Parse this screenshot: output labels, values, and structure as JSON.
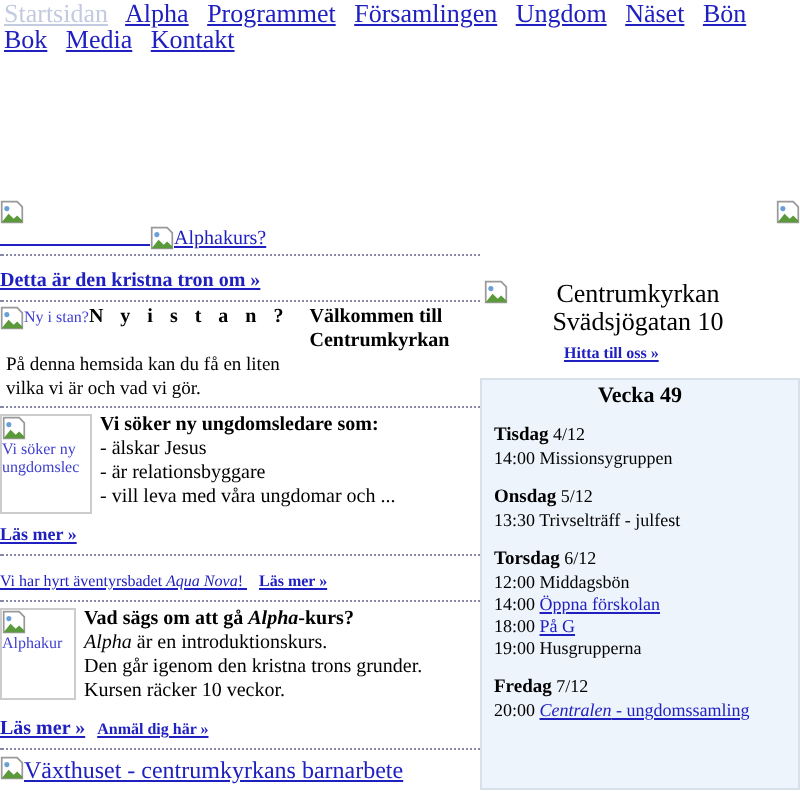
{
  "nav": [
    {
      "label": "Startsidan",
      "selected": true
    },
    {
      "label": "Alpha",
      "selected": false
    },
    {
      "label": "Programmet",
      "selected": false
    },
    {
      "label": "Församlingen",
      "selected": false
    },
    {
      "label": "Ungdom",
      "selected": false
    },
    {
      "label": "Näset",
      "selected": false
    },
    {
      "label": "Bön",
      "selected": false
    },
    {
      "label": "Bok",
      "selected": false
    },
    {
      "label": "Media",
      "selected": false
    },
    {
      "label": "Kontakt",
      "selected": false
    }
  ],
  "left": {
    "alpha_link": "Alphakurs?",
    "faith_link": "Detta är den kristna tron om »",
    "welcome": {
      "image_alt": "Ny i stan?",
      "title": "N y i s t a n ?",
      "heading": "Välkommen till Centrumkyrkan",
      "lines": [
        "På denna hemsida kan du få en liten",
        "vilka vi är och vad vi gör."
      ]
    },
    "youth": {
      "image_alt": "Vi söker ny ungdomslec",
      "heading": "Vi söker ny ungdomsledare som:",
      "lines": [
        "- älskar Jesus",
        "- är relationsbyggare",
        "- vill leva med våra ungdomar och ..."
      ],
      "link": "Läs mer »"
    },
    "aqua": {
      "text": "Vi har hyrt äventyrsbadet *Aqua Nova*!",
      "link": "Läs mer »"
    },
    "alpha": {
      "image_alt": "Alphakur",
      "heading": "Vad sägs om att gå *Alpha*-kurs?",
      "lines": [
        "*Alpha* är en introduktionskurs.",
        "Den går igenom den kristna trons grunder.",
        "Kursen räcker 10 veckor."
      ],
      "links": [
        "Läs mer »",
        "Anmäl dig här »"
      ]
    },
    "vaxthuset": "Växthuset - centrumkyrkans barnarbete"
  },
  "right": {
    "name": "Centrumkyrkan",
    "address": "Svädsjögatan 10",
    "link": "Hitta till oss »",
    "calendar": {
      "title": "Vecka 49",
      "days": [
        {
          "day": "Tisdag",
          "date": "4/12",
          "events": [
            {
              "time": "14:00",
              "title": "Missionsygruppen",
              "kind": "text"
            }
          ]
        },
        {
          "day": "Onsdag",
          "date": "5/12",
          "events": [
            {
              "time": "13:30",
              "title": "Trivselträff - julfest",
              "kind": "text"
            }
          ]
        },
        {
          "day": "Torsdag",
          "date": "6/12",
          "events": [
            {
              "time": "12:00",
              "title": "Middagsbön",
              "kind": "text"
            },
            {
              "time": "14:00",
              "title": "Öppna förskolan",
              "kind": "link"
            },
            {
              "time": "18:00",
              "title": "På G",
              "kind": "link"
            },
            {
              "time": "19:00",
              "title": "Husgrupperna",
              "kind": "text"
            }
          ]
        },
        {
          "day": "Fredag",
          "date": "7/12",
          "events": [
            {
              "time": "20:00",
              "title": "*Centralen* - ungdomssamling",
              "kind": "link"
            }
          ]
        }
      ]
    }
  }
}
